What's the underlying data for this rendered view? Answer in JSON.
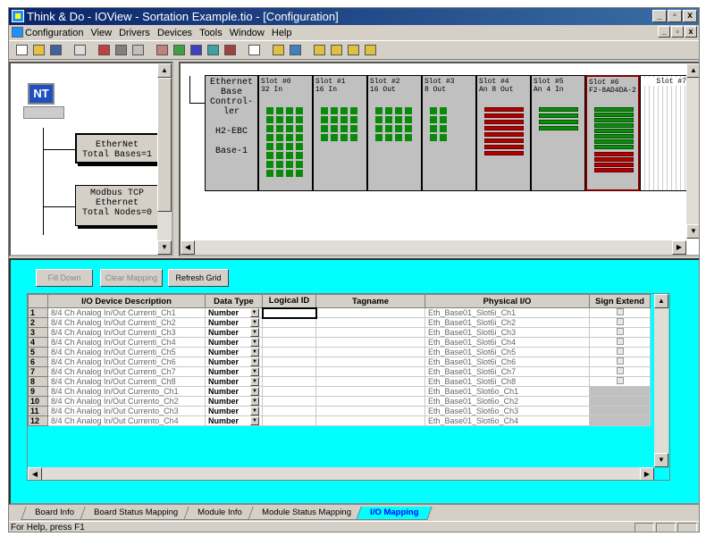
{
  "window": {
    "title": "Think & Do - IOView - Sortation Example.tio - [Configuration]"
  },
  "menu": [
    "Configuration",
    "View",
    "Drivers",
    "Devices",
    "Tools",
    "Window",
    "Help"
  ],
  "tree": {
    "nt_label": "NT",
    "ethernet_box": [
      "EtherNet",
      "Total Bases=1"
    ],
    "modbus_box": [
      "Modbus TCP",
      "Ethernet",
      "Total Nodes=0"
    ]
  },
  "rack": {
    "controller": [
      "Ethernet",
      "Base",
      "Control-",
      "ler",
      "",
      "H2-EBC",
      "",
      "Base-1"
    ],
    "slots": [
      {
        "name": "Slot #0",
        "desc": "32 In"
      },
      {
        "name": "Slot #1",
        "desc": "16 In"
      },
      {
        "name": "Slot #2",
        "desc": "16 Out"
      },
      {
        "name": "Slot #3",
        "desc": "8 Out"
      },
      {
        "name": "Slot #4",
        "desc": "An 8 Out"
      },
      {
        "name": "Slot #5",
        "desc": "An 4 In"
      },
      {
        "name": "Slot #6",
        "desc": "F2-8AD4DA-2"
      },
      {
        "name": "Slot #7",
        "desc": ""
      }
    ]
  },
  "buttons": {
    "fill_down": "Fill Down",
    "clear_mapping": "Clear Mapping",
    "refresh_grid": "Refresh Grid"
  },
  "grid": {
    "headers": [
      "I/O Device Description",
      "Data Type",
      "Logical ID",
      "Tagname",
      "Physical I/O",
      "Sign Extend"
    ],
    "rows": [
      {
        "n": "1",
        "desc": "8/4 Ch Analog In/Out Currenti_Ch1",
        "type": "Number",
        "phys": "Eth_Base01_Slot6i_Ch1"
      },
      {
        "n": "2",
        "desc": "8/4 Ch Analog In/Out Currenti_Ch2",
        "type": "Number",
        "phys": "Eth_Base01_Slot6i_Ch2"
      },
      {
        "n": "3",
        "desc": "8/4 Ch Analog In/Out Currenti_Ch3",
        "type": "Number",
        "phys": "Eth_Base01_Slot6i_Ch3"
      },
      {
        "n": "4",
        "desc": "8/4 Ch Analog In/Out Currenti_Ch4",
        "type": "Number",
        "phys": "Eth_Base01_Slot6i_Ch4"
      },
      {
        "n": "5",
        "desc": "8/4 Ch Analog In/Out Currenti_Ch5",
        "type": "Number",
        "phys": "Eth_Base01_Slot6i_Ch5"
      },
      {
        "n": "6",
        "desc": "8/4 Ch Analog In/Out Currenti_Ch6",
        "type": "Number",
        "phys": "Eth_Base01_Slot6i_Ch6"
      },
      {
        "n": "7",
        "desc": "8/4 Ch Analog In/Out Currenti_Ch7",
        "type": "Number",
        "phys": "Eth_Base01_Slot6i_Ch7"
      },
      {
        "n": "8",
        "desc": "8/4 Ch Analog In/Out Currenti_Ch8",
        "type": "Number",
        "phys": "Eth_Base01_Slot6i_Ch8"
      },
      {
        "n": "9",
        "desc": "8/4 Ch Analog In/Out Currento_Ch1",
        "type": "Number",
        "phys": "Eth_Base01_Slot6o_Ch1"
      },
      {
        "n": "10",
        "desc": "8/4 Ch Analog In/Out Currento_Ch2",
        "type": "Number",
        "phys": "Eth_Base01_Slot6o_Ch2"
      },
      {
        "n": "11",
        "desc": "8/4 Ch Analog In/Out Currento_Ch3",
        "type": "Number",
        "phys": "Eth_Base01_Slot6o_Ch3"
      },
      {
        "n": "12",
        "desc": "8/4 Ch Analog In/Out Currento_Ch4",
        "type": "Number",
        "phys": "Eth_Base01_Slot6o_Ch4"
      }
    ]
  },
  "tabs": [
    "Board Info",
    "Board Status Mapping",
    "Module Info",
    "Module Status Mapping",
    "I/O Mapping"
  ],
  "active_tab": "I/O Mapping",
  "status": "For Help, press F1",
  "colors": {
    "grid_bg": "#00ffff",
    "title_start": "#0a246a",
    "led_green": "#0a8a0a",
    "led_red": "#b00000"
  }
}
